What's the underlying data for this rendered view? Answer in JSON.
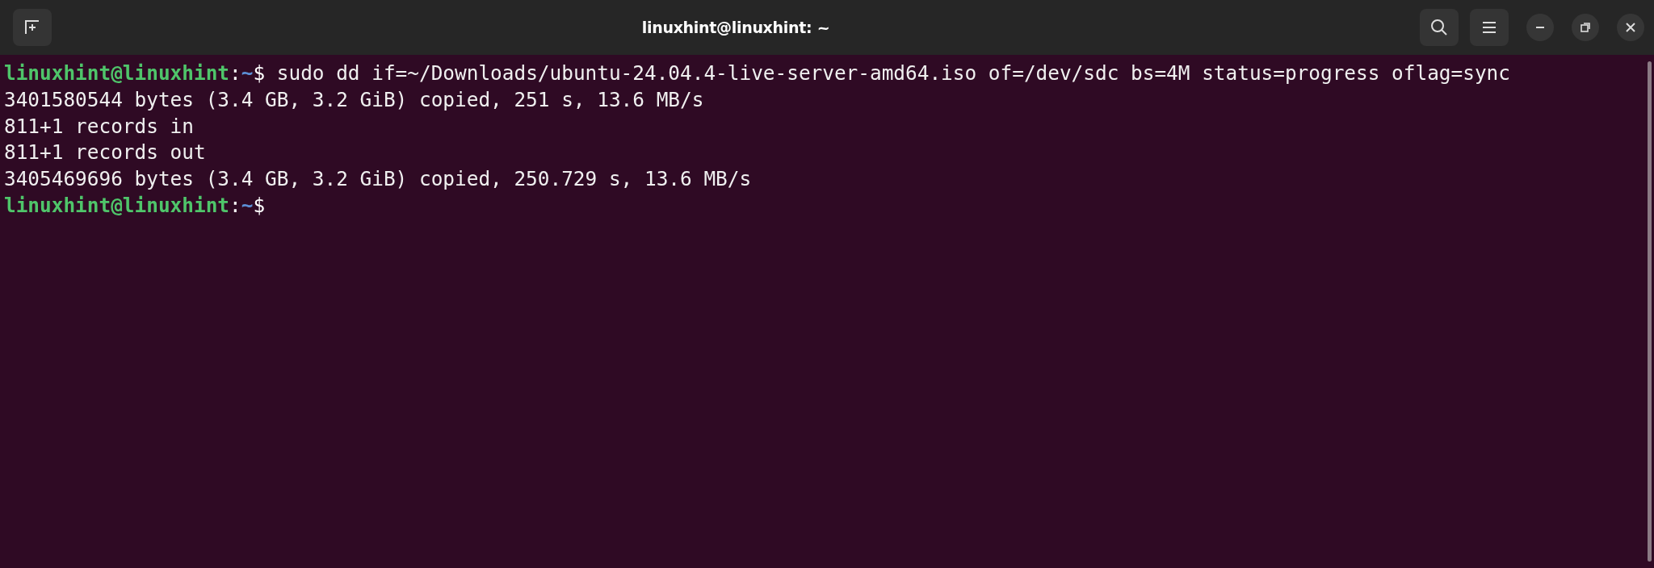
{
  "window": {
    "title": "linuxhint@linuxhint: ~"
  },
  "terminal": {
    "lines": [
      {
        "kind": "prompt",
        "user_host": "linuxhint@linuxhint",
        "separator": ":",
        "path": "~",
        "symbol": "$",
        "command": "sudo dd if=~/Downloads/ubuntu-24.04.4-live-server-amd64.iso of=/dev/sdc bs=4M status=progress oflag=sync"
      },
      {
        "kind": "output",
        "text": "3401580544 bytes (3.4 GB, 3.2 GiB) copied, 251 s, 13.6 MB/s"
      },
      {
        "kind": "output",
        "text": "811+1 records in"
      },
      {
        "kind": "output",
        "text": "811+1 records out"
      },
      {
        "kind": "output",
        "text": "3405469696 bytes (3.4 GB, 3.2 GiB) copied, 250.729 s, 13.6 MB/s"
      },
      {
        "kind": "prompt",
        "user_host": "linuxhint@linuxhint",
        "separator": ":",
        "path": "~",
        "symbol": "$"
      }
    ]
  }
}
